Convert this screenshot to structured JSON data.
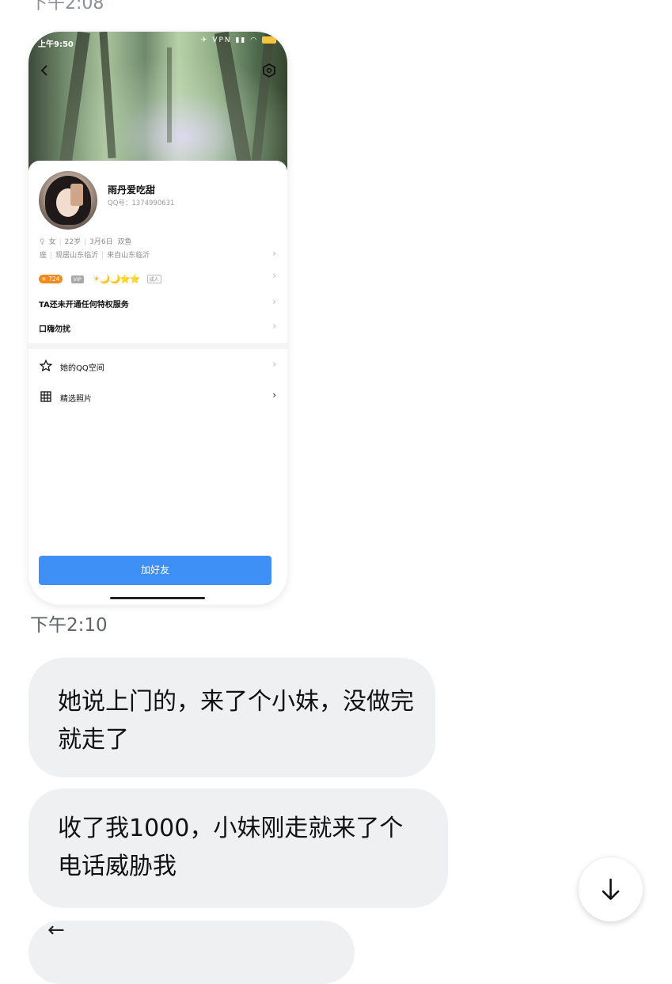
{
  "top_partial_time": "下午2:08",
  "profile_card": {
    "status_bar": {
      "time": "上午9:50",
      "vpn_label": "VPN"
    },
    "nickname": "雨丹爱吃甜",
    "qq_number": "QQ号：1374990631",
    "info_line_1": {
      "gender_icon": "♀",
      "gender": "女",
      "age": "22岁",
      "birthday": "3月6日",
      "zodiac_start": "双鱼"
    },
    "info_line_2": {
      "zodiac_end": "座",
      "residence": "现居山东临沂",
      "hometown": "来自山东临沂"
    },
    "badges": {
      "level": "724",
      "vip": "VIP",
      "level_icons": "☀🌙🌙⭐⭐",
      "adult_label": "成人"
    },
    "privilege_text": "TA还未开通任何特权服务",
    "signature": "口嗨勿扰",
    "menu": [
      {
        "icon": "star-icon",
        "label": "她的QQ空间"
      },
      {
        "icon": "grid-icon",
        "label": "精选照片"
      }
    ],
    "add_friend_label": "加好友"
  },
  "chat": {
    "timestamp": "下午2:10",
    "messages": [
      {
        "text": "她说上门的，来了个小妹，没做完就走了"
      },
      {
        "text": "收了我1000，小妹刚走就来了个电话威胁我"
      }
    ],
    "third_bubble_icon": "←"
  },
  "icons": {
    "scroll_down": "arrow-down-icon",
    "back": "chevron-left-icon",
    "settings": "hexagon-settings-icon"
  },
  "colors": {
    "add_button": "#3e90f7",
    "bubble_bg": "#eef0f2",
    "timestamp": "#5d646c"
  }
}
